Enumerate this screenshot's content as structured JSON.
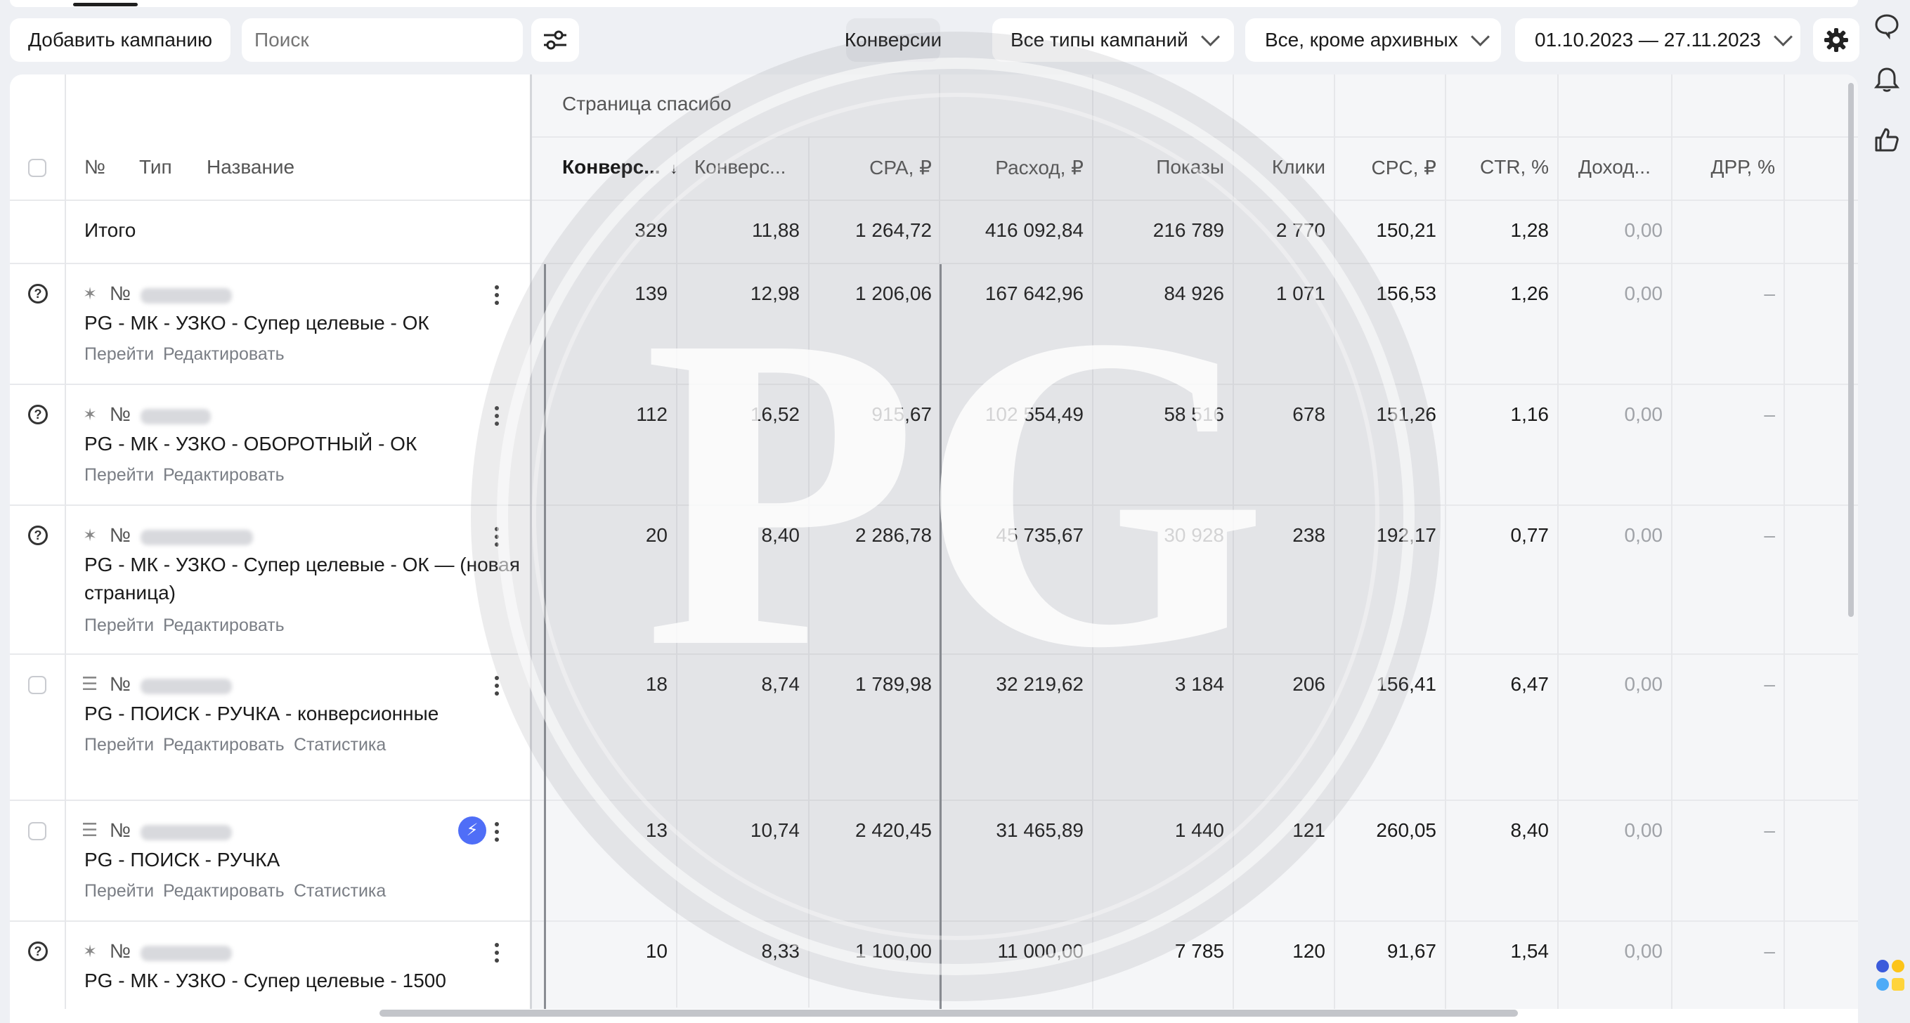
{
  "toolbar": {
    "add_campaign": "Добавить кампанию",
    "search_placeholder": "Поиск",
    "conversions": "Конверсии",
    "campaign_types": "Все типы кампаний",
    "archive_filter": "Все, кроме архивных",
    "date_range": "01.10.2023 — 27.11.2023"
  },
  "table": {
    "group_header": "Страница спасибо",
    "columns": {
      "num": "№",
      "type": "Тип",
      "name": "Название",
      "conv1": "Конверс...",
      "sort_arrow": "↓",
      "conv2": "Конверс...",
      "cpa": "CPA, ₽",
      "spend": "Расход, ₽",
      "shows": "Показы",
      "clicks": "Клики",
      "cpc": "CPC, ₽",
      "ctr": "CTR, %",
      "income": "Доход...",
      "drr": "ДРР, %"
    },
    "total": {
      "label": "Итого",
      "conv1": "329",
      "conv2": "11,88",
      "cpa": "1 264,72",
      "spend": "416 092,84",
      "shows": "216 789",
      "clicks": "2 770",
      "cpc": "150,21",
      "ctr": "1,28",
      "income": "0,00"
    },
    "rows": [
      {
        "num_label": "№",
        "name": "PG - МК - УЗКО - Супер целевые - ОК",
        "name2": "",
        "link1": "Перейти",
        "link2": "Редактировать",
        "link3": "",
        "conv1": "139",
        "conv2": "12,98",
        "cpa": "1 206,06",
        "spend": "167 642,96",
        "shows": "84 926",
        "clicks": "1 071",
        "cpc": "156,53",
        "ctr": "1,26",
        "income": "0,00",
        "drr": "–"
      },
      {
        "num_label": "№",
        "name": "PG - МК - УЗКО - ОБОРОТНЫЙ - ОК",
        "name2": "",
        "link1": "Перейти",
        "link2": "Редактировать",
        "link3": "",
        "conv1": "112",
        "conv2": "16,52",
        "cpa": "915,67",
        "spend": "102 554,49",
        "shows": "58 516",
        "clicks": "678",
        "cpc": "151,26",
        "ctr": "1,16",
        "income": "0,00",
        "drr": "–"
      },
      {
        "num_label": "№",
        "name": "PG - МК - УЗКО - Супер целевые - ОК — (новая",
        "name2": "страница)",
        "link1": "Перейти",
        "link2": "Редактировать",
        "link3": "",
        "conv1": "20",
        "conv2": "8,40",
        "cpa": "2 286,78",
        "spend": "45 735,67",
        "shows": "30 928",
        "clicks": "238",
        "cpc": "192,17",
        "ctr": "0,77",
        "income": "0,00",
        "drr": "–"
      },
      {
        "num_label": "№",
        "name": "PG - ПОИСК - РУЧКА - конверсионные",
        "name2": "",
        "link1": "Перейти",
        "link2": "Редактировать",
        "link3": "Статистика",
        "conv1": "18",
        "conv2": "8,74",
        "cpa": "1 789,98",
        "spend": "32 219,62",
        "shows": "3 184",
        "clicks": "206",
        "cpc": "156,41",
        "ctr": "6,47",
        "income": "0,00",
        "drr": "–"
      },
      {
        "num_label": "№",
        "name": "PG - ПОИСК - РУЧКА",
        "name2": "",
        "link1": "Перейти",
        "link2": "Редактировать",
        "link3": "Статистика",
        "conv1": "13",
        "conv2": "10,74",
        "cpa": "2 420,45",
        "spend": "31 465,89",
        "shows": "1 440",
        "clicks": "121",
        "cpc": "260,05",
        "ctr": "8,40",
        "income": "0,00",
        "drr": "–"
      },
      {
        "num_label": "№",
        "name": "PG - МК - УЗКО - Супер целевые - 1500",
        "name2": "",
        "link1": "",
        "link2": "",
        "link3": "",
        "conv1": "10",
        "conv2": "8,33",
        "cpa": "1 100,00",
        "spend": "11 000,00",
        "shows": "7 785",
        "clicks": "120",
        "cpc": "91,67",
        "ctr": "1,54",
        "income": "0,00",
        "drr": "–"
      }
    ]
  },
  "watermark": "PG",
  "icons": {
    "filter": "sliders-icon",
    "settings": "gear-icon",
    "chat": "chat-icon",
    "bell": "bell-icon",
    "like": "thumbs-up-icon",
    "lightning": "lightning-icon",
    "help": "question-circle-icon"
  },
  "colors": {
    "accent_blue": "#4f6ef7",
    "page_bg": "#eef0f4"
  }
}
